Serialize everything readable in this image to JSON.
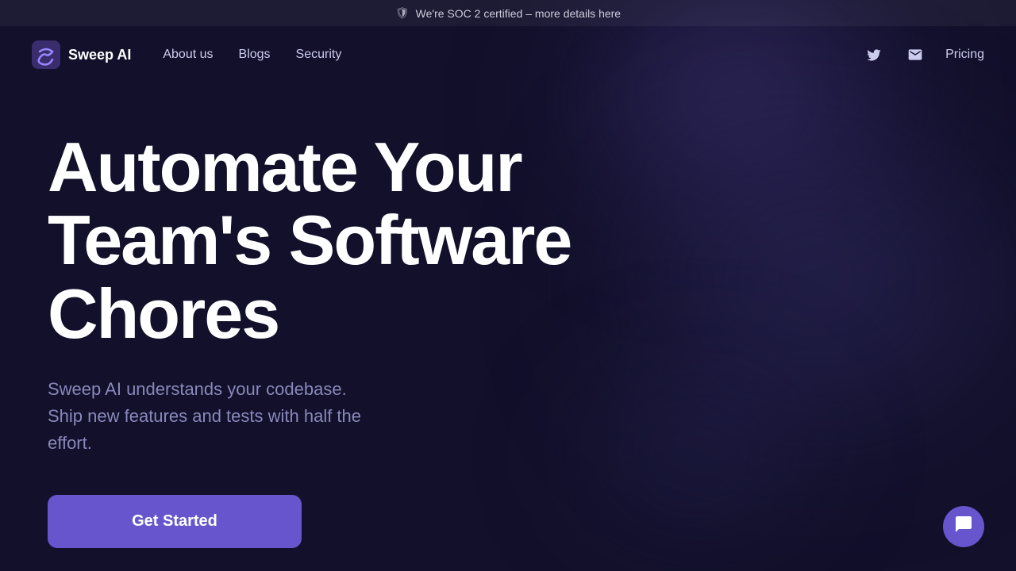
{
  "banner": {
    "shield_icon": "🛡",
    "text": "We're SOC 2 certified – more details here"
  },
  "navbar": {
    "logo_text": "Sweep AI",
    "links": [
      {
        "label": "About us",
        "id": "about-us"
      },
      {
        "label": "Blogs",
        "id": "blogs"
      },
      {
        "label": "Security",
        "id": "security"
      }
    ],
    "pricing_label": "Pricing"
  },
  "hero": {
    "title": "Automate Your Team's Software Chores",
    "subtitle": "Sweep AI understands your codebase. Ship new features and tests with half the effort.",
    "cta_label": "Get Started"
  },
  "chat": {
    "icon": "💬"
  }
}
